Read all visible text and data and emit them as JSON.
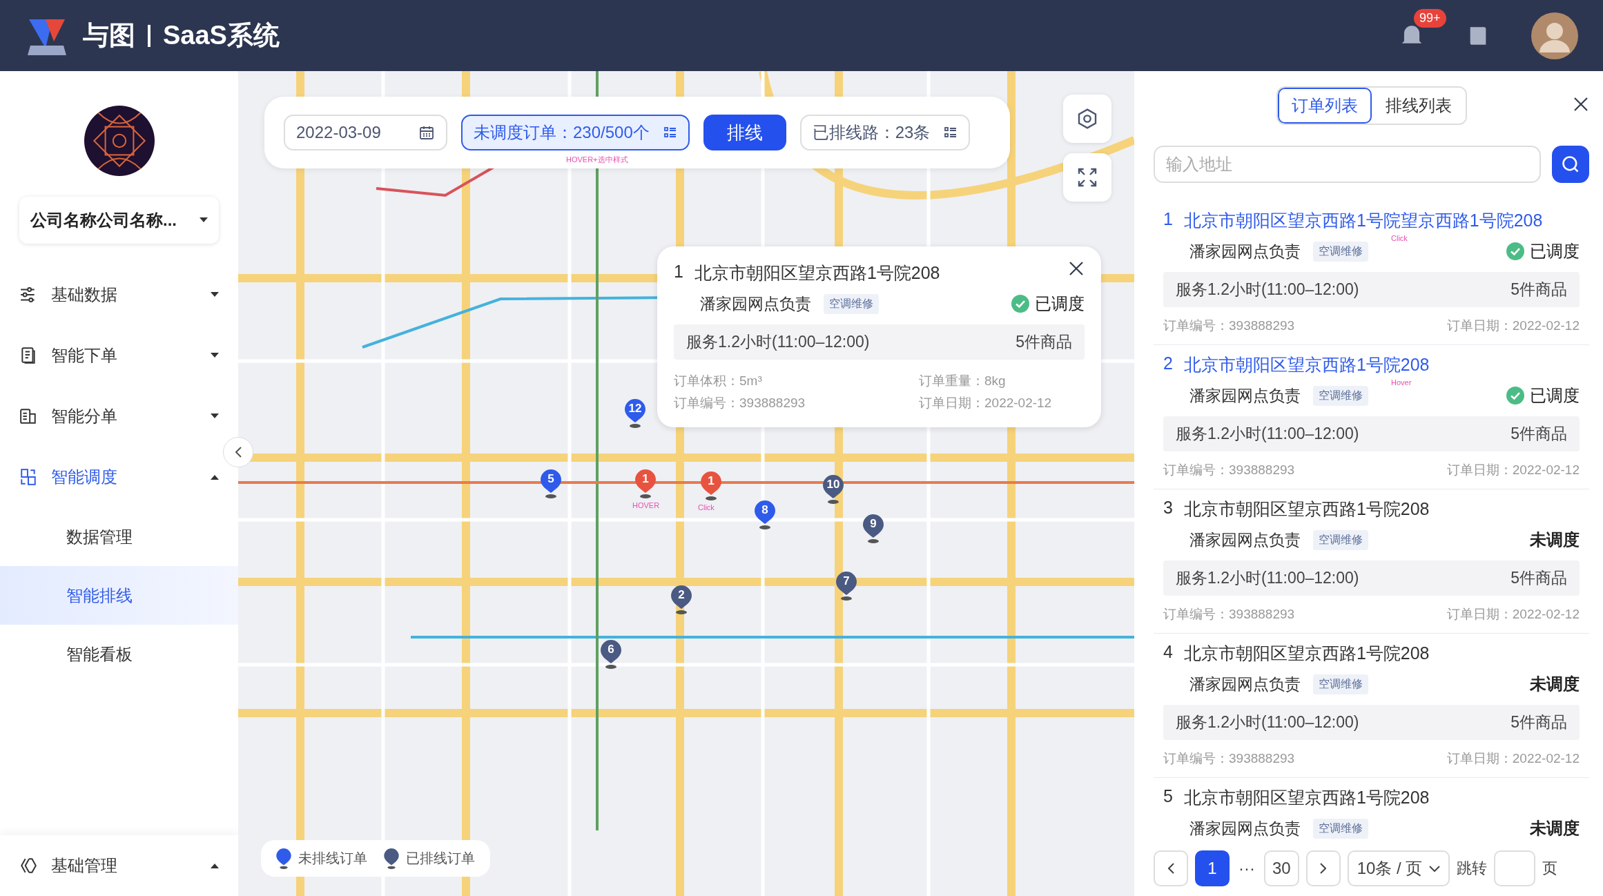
{
  "header": {
    "brand": "与图",
    "product": "SaaS系统",
    "notification_badge": "99+"
  },
  "sidebar": {
    "company_select": "公司名称公司名称...",
    "menu": [
      {
        "label": "基础数据",
        "expanded": false,
        "selected": false
      },
      {
        "label": "智能下单",
        "expanded": false,
        "selected": false
      },
      {
        "label": "智能分单",
        "expanded": false,
        "selected": false
      },
      {
        "label": "智能调度",
        "expanded": true,
        "selected": true,
        "children": [
          {
            "label": "数据管理",
            "selected": false
          },
          {
            "label": "智能排线",
            "selected": true
          },
          {
            "label": "智能看板",
            "selected": false
          }
        ]
      }
    ],
    "footer_item": {
      "label": "基础管理",
      "expanded": true
    }
  },
  "map": {
    "toolbar": {
      "date": "2022-03-09",
      "unscheduled": {
        "label": "未调度订单：230/500个",
        "selected": true
      },
      "annotation": "HOVER+选中样式",
      "route_button": "排线",
      "routed": "已排线路：23条"
    },
    "markers": [
      {
        "label": "12",
        "color": "#2f5bea"
      },
      {
        "label": "5",
        "color": "#2f5bea"
      },
      {
        "label": "1",
        "color": "#e8533f",
        "annotation": "HOVER"
      },
      {
        "label": "1",
        "color": "#e8533f",
        "annotation": "Click"
      },
      {
        "label": "8",
        "color": "#2f5bea"
      },
      {
        "label": "10",
        "color": "#4a5a82"
      },
      {
        "label": "9",
        "color": "#4a5a82"
      },
      {
        "label": "7",
        "color": "#4a5a82"
      },
      {
        "label": "2",
        "color": "#4a5a82"
      },
      {
        "label": "6",
        "color": "#4a5a82"
      }
    ],
    "popup": {
      "number": "1",
      "title": "北京市朝阳区望京西路1号院208",
      "owner": "潘家园网点负责",
      "tag": "空调维修",
      "status": "已调度",
      "scheduled": true,
      "service": "服务1.2小时(11:00–12:00)",
      "goods": "5件商品",
      "volume": "订单体积：5m³",
      "weight": "订单重量：8kg",
      "order_no": "订单编号：393888293",
      "date": "订单日期：2022-02-12"
    },
    "legend": [
      {
        "label": "未排线订单",
        "color": "#2f5bea"
      },
      {
        "label": "已排线订单",
        "color": "#4a5a82"
      }
    ]
  },
  "panel": {
    "tabs": [
      {
        "label": "订单列表",
        "selected": true
      },
      {
        "label": "排线列表",
        "selected": false
      }
    ],
    "search": {
      "placeholder": "输入地址"
    },
    "orders": [
      {
        "number": "1",
        "title": "北京市朝阳区望京西路1号院望京西路1号院208",
        "highlighted": true,
        "annotation": "Click",
        "owner": "潘家园网点负责",
        "tag": "空调维修",
        "status": "已调度",
        "scheduled": true,
        "service": "服务1.2小时(11:00–12:00)",
        "goods": "5件商品",
        "order_no": "订单编号：393888293",
        "date": "订单日期：2022-02-12"
      },
      {
        "number": "2",
        "title": "北京市朝阳区望京西路1号院208",
        "highlighted": true,
        "annotation": "Hover",
        "owner": "潘家园网点负责",
        "tag": "空调维修",
        "status": "已调度",
        "scheduled": true,
        "service": "服务1.2小时(11:00–12:00)",
        "goods": "5件商品",
        "order_no": "订单编号：393888293",
        "date": "订单日期：2022-02-12"
      },
      {
        "number": "3",
        "title": "北京市朝阳区望京西路1号院208",
        "highlighted": false,
        "owner": "潘家园网点负责",
        "tag": "空调维修",
        "status": "未调度",
        "scheduled": false,
        "service": "服务1.2小时(11:00–12:00)",
        "goods": "5件商品",
        "order_no": "订单编号：393888293",
        "date": "订单日期：2022-02-12"
      },
      {
        "number": "4",
        "title": "北京市朝阳区望京西路1号院208",
        "highlighted": false,
        "owner": "潘家园网点负责",
        "tag": "空调维修",
        "status": "未调度",
        "scheduled": false,
        "service": "服务1.2小时(11:00–12:00)",
        "goods": "5件商品",
        "order_no": "订单编号：393888293",
        "date": "订单日期：2022-02-12"
      },
      {
        "number": "5",
        "title": "北京市朝阳区望京西路1号院208",
        "highlighted": false,
        "owner": "潘家园网点负责",
        "tag": "空调维修",
        "status": "未调度",
        "scheduled": false
      }
    ],
    "pagination": {
      "pages": [
        {
          "label": "1",
          "selected": true
        },
        {
          "label": "30",
          "selected": false
        }
      ],
      "ellipsis": "···",
      "page_size": "10条 / 页",
      "jump_label": "跳转",
      "page_unit": "页"
    }
  }
}
